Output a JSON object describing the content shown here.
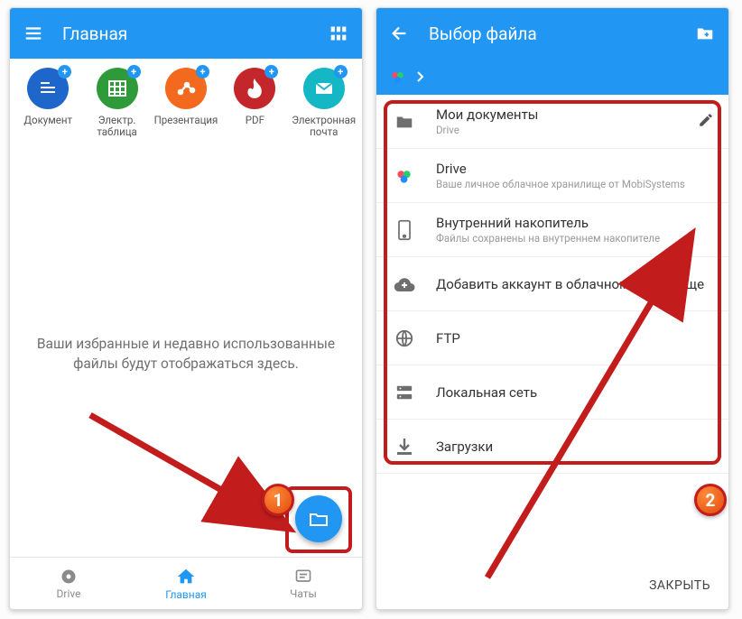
{
  "left": {
    "appbar": {
      "title": "Главная"
    },
    "create": [
      {
        "label": "Документ",
        "color": "#1e66c9",
        "icon": "doc"
      },
      {
        "label": "Электр. таблица",
        "color": "#2e9a3a",
        "icon": "sheet"
      },
      {
        "label": "Презентация",
        "color": "#f36a1f",
        "icon": "pres"
      },
      {
        "label": "PDF",
        "color": "#c3272b",
        "icon": "pdf"
      },
      {
        "label": "Электронная почта",
        "color": "#15b7c4",
        "icon": "mail"
      }
    ],
    "empty_text": "Ваши избранные и недавно использованные файлы будут отображаться здесь.",
    "bottom_nav": [
      {
        "label": "Drive",
        "icon": "drive",
        "active": false
      },
      {
        "label": "Главная",
        "icon": "home",
        "active": true
      },
      {
        "label": "Чаты",
        "icon": "chat",
        "active": false
      }
    ]
  },
  "right": {
    "appbar": {
      "title": "Выбор файла"
    },
    "rows": [
      {
        "icon": "folder",
        "primary": "Мои документы",
        "secondary": "Drive",
        "trail": "pencil"
      },
      {
        "icon": "drive-color",
        "primary": "Drive",
        "secondary": "Ваше личное облачное хранилище от MobiSystems"
      },
      {
        "icon": "phone",
        "primary": "Внутренний накопитель",
        "secondary": "Файлы сохранены на внутреннем накопителе"
      },
      {
        "icon": "cloud-plus",
        "primary": "Добавить аккаунт в облачном хранилище"
      },
      {
        "icon": "globe",
        "primary": "FTP"
      },
      {
        "icon": "lan",
        "primary": "Локальная сеть"
      },
      {
        "icon": "download",
        "primary": "Загрузки"
      }
    ],
    "footer": {
      "close": "ЗАКРЫТЬ"
    }
  },
  "annotations": {
    "badge1": "1",
    "badge2": "2"
  }
}
